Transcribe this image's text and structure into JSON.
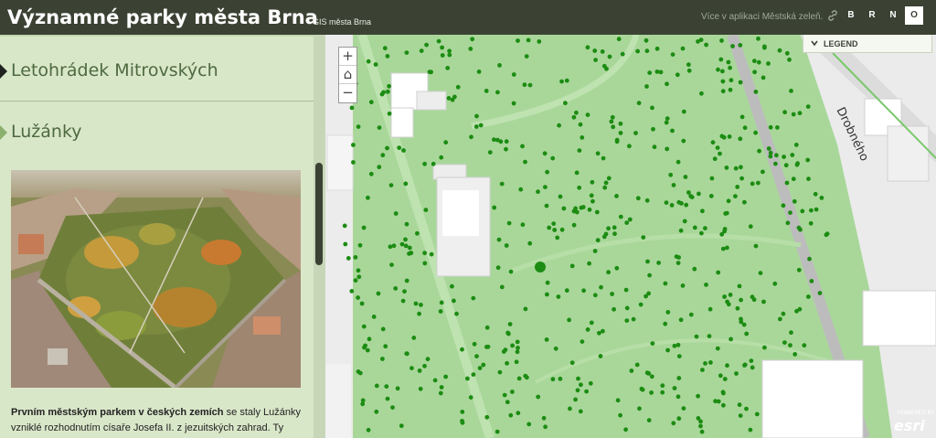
{
  "header": {
    "title": "Významné parky města Brna",
    "subtitle": "GIS města Brna",
    "more_link": "Více v aplikaci Městská zeleň.",
    "brand_letters": [
      "B",
      "R",
      "N",
      "O"
    ]
  },
  "sidebar": {
    "sections": [
      {
        "title": "Letohrádek Mitrovských",
        "active": true
      },
      {
        "title": "Lužánky",
        "active": false
      }
    ],
    "description_bold": "Prvním městským parkem v českých zemích",
    "description_rest": " se staly Lužánky vzniklé rozhodnutím císaře Josefa II. z jezuitských zahrad. Ty"
  },
  "map": {
    "zoom_in": "+",
    "home": "⌂",
    "zoom_out": "−",
    "legend_label": "LEGEND",
    "street_label": "Drobného",
    "esri_label": "esri",
    "esri_small": "POWERED BY",
    "colors": {
      "lawn": "#a9d79a",
      "path": "#bcdfae",
      "tree": "#1c8c12",
      "building": "#ffffff"
    }
  }
}
